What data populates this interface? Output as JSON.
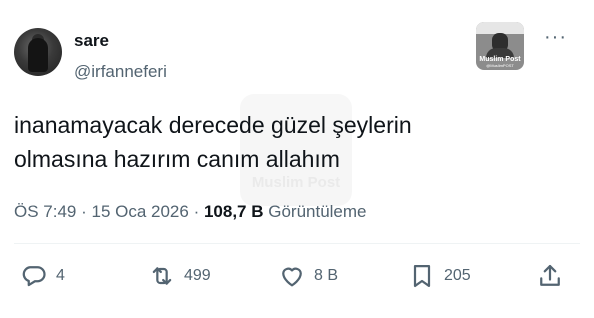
{
  "author": {
    "name": "sare",
    "handle": "@irfanneferi"
  },
  "badge": {
    "title": "Muslim Post",
    "subtitle": "@MuslimPOST"
  },
  "watermark": {
    "title": "Muslim Post"
  },
  "tweet": {
    "lines": [
      "inanamayacak derecede güzel şeylerin",
      "olmasına hazırım canım allahım"
    ]
  },
  "meta": {
    "time": "ÖS 7:49",
    "separator": " · ",
    "date": "15 Oca 2026",
    "views_count": "108,7 B",
    "views_label": "Görüntüleme"
  },
  "actions": {
    "reply": {
      "icon": "reply-icon",
      "count": "4"
    },
    "retweet": {
      "icon": "retweet-icon",
      "count": "499"
    },
    "like": {
      "icon": "heart-icon",
      "count": "8 B"
    },
    "bookmark": {
      "icon": "bookmark-icon",
      "count": "205"
    },
    "share": {
      "icon": "share-icon"
    }
  },
  "colors": {
    "text": "#0f1419",
    "secondary": "#536471",
    "divider": "#eff3f4"
  }
}
